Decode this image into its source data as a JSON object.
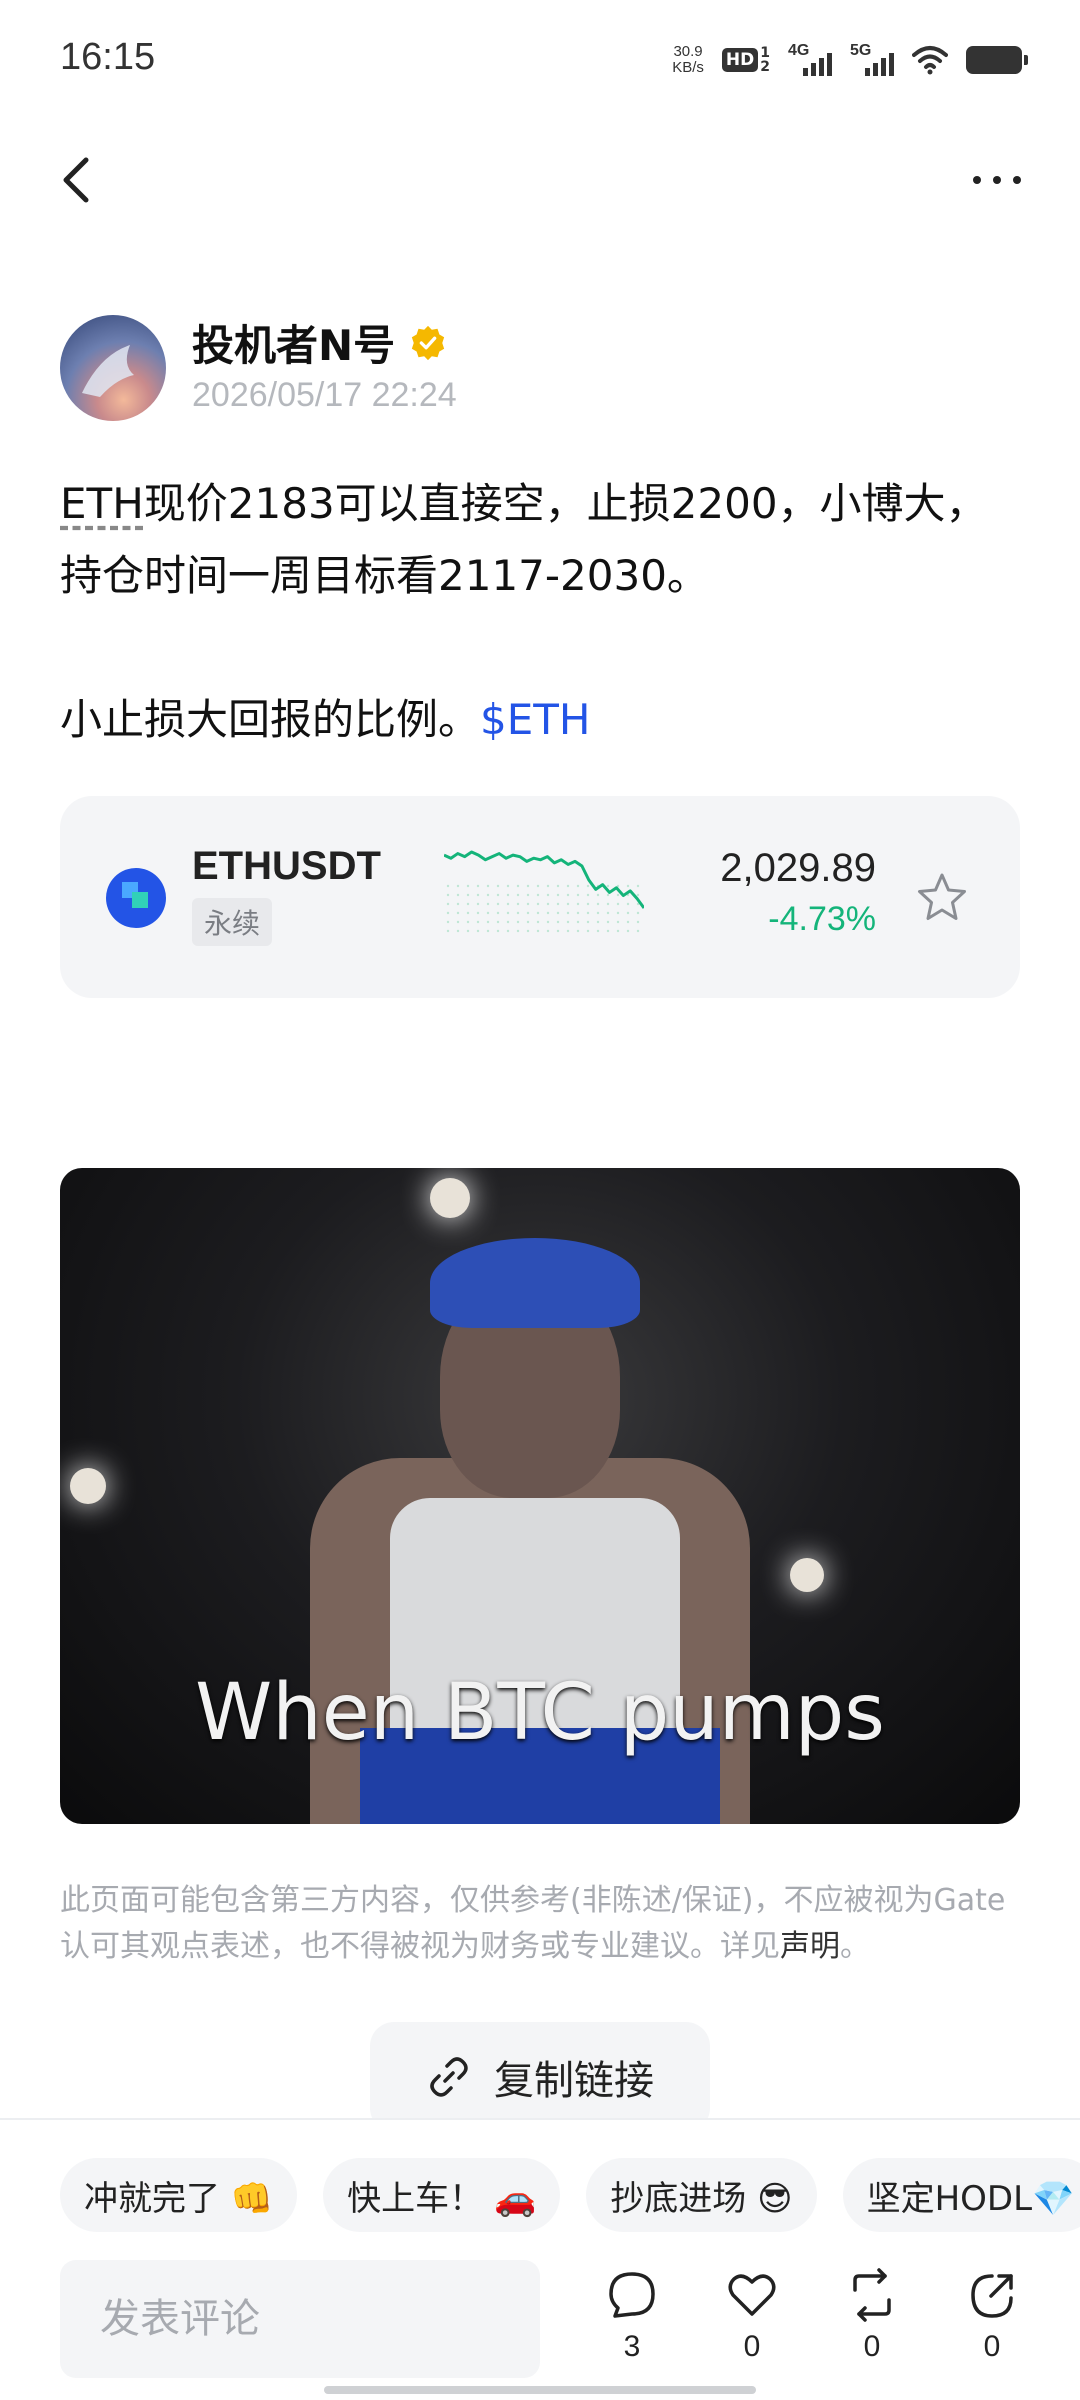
{
  "status_bar": {
    "time": "16:15",
    "net_speed_value": "30.9",
    "net_speed_unit": "KB/s",
    "hd_label": "HD",
    "hd_sim": "1",
    "hd_sim2": "2",
    "network_1": "4G",
    "network_2": "5G"
  },
  "nav": {
    "back_icon": "chevron-left-icon",
    "more_icon": "more-dots-icon"
  },
  "author": {
    "name": "投机者N号",
    "verified_color": "#F5B800",
    "timestamp": "2026/05/17 22:24"
  },
  "post": {
    "line1_ticker": "ETH",
    "line1_rest": "现价2183可以直接空，止损2200，小博大，",
    "line2": "持仓时间一周目标看2117-2030。",
    "line3_text": "小止损大回报的比例。",
    "line3_tag": "$ETH"
  },
  "ticker_card": {
    "pair": "ETHUSDT",
    "type": "永续",
    "price": "2,029.89",
    "change": "-4.73%",
    "change_color": "#14B47A",
    "sparkline": [
      52,
      50,
      53,
      51,
      54,
      52,
      49,
      51,
      53,
      50,
      52,
      51,
      48,
      50,
      49,
      51,
      47,
      49,
      46,
      48,
      45,
      36,
      30,
      33,
      28,
      31,
      26,
      29,
      24,
      18
    ]
  },
  "media": {
    "caption": "When BTC pumps"
  },
  "disclaimer": {
    "line1": "此页面可能包含第三方内容，仅供参考(非陈述/保证)，不应被视为Gate",
    "line2_text": "认可其观点表述，也不得被视为财务或专业建议。详见",
    "link": "声明",
    "line2_end": "。"
  },
  "copy_link": {
    "label": "复制链接"
  },
  "quick_replies": [
    "冲就完了 👊",
    "快上车！ 🚗",
    "抄底进场 😎",
    "坚定HODL💎"
  ],
  "comment": {
    "placeholder": "发表评论"
  },
  "actions": {
    "comments": "3",
    "likes": "0",
    "reposts": "0",
    "shares": "0"
  }
}
